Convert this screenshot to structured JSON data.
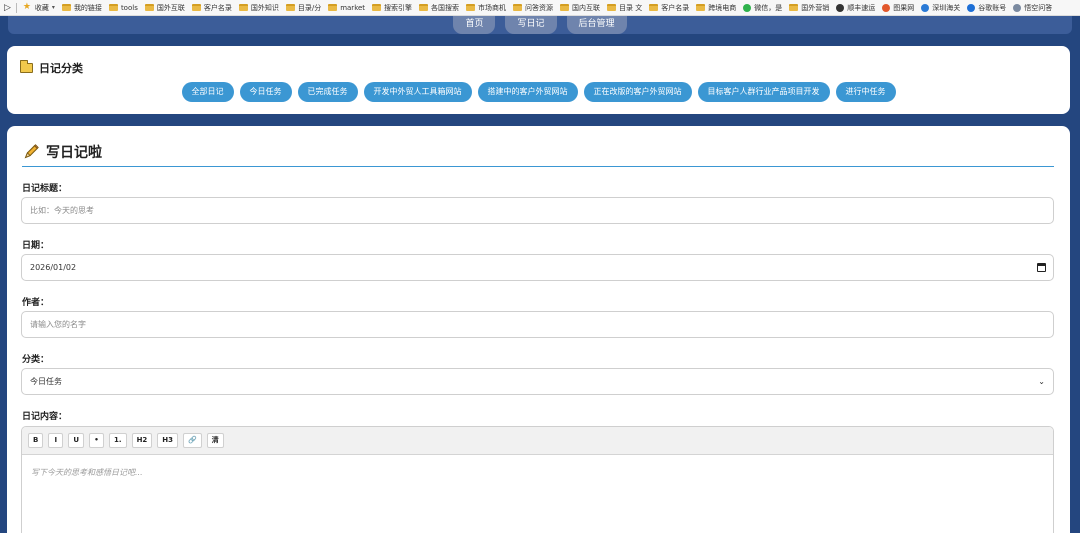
{
  "bookmarks": [
    {
      "label": "收藏",
      "icon": "star-icon",
      "caret": "▾"
    },
    {
      "label": "我的链接",
      "icon": "folder-icon"
    },
    {
      "label": "tools",
      "icon": "folder-icon"
    },
    {
      "label": "国外互联",
      "icon": "folder-icon"
    },
    {
      "label": "客户名录",
      "icon": "folder-icon"
    },
    {
      "label": "国外知识",
      "icon": "folder-icon"
    },
    {
      "label": "目录/分",
      "icon": "folder-icon"
    },
    {
      "label": "market",
      "icon": "folder-icon"
    },
    {
      "label": "搜索引擎",
      "icon": "folder-icon"
    },
    {
      "label": "各国搜索",
      "icon": "folder-icon"
    },
    {
      "label": "市场商机",
      "icon": "folder-icon"
    },
    {
      "label": "问答资源",
      "icon": "folder-icon"
    },
    {
      "label": "国内互联",
      "icon": "folder-icon"
    },
    {
      "label": "目录 文",
      "icon": "folder-icon"
    },
    {
      "label": "客户名录",
      "icon": "folder-icon"
    },
    {
      "label": "跨境电商",
      "icon": "folder-icon"
    },
    {
      "label": "微信，是",
      "icon": "wechat-icon"
    },
    {
      "label": "国外营销",
      "icon": "folder-icon"
    },
    {
      "label": "顺丰速运",
      "icon": "sf-express-icon"
    },
    {
      "label": "图果网",
      "icon": "tuguo-icon"
    },
    {
      "label": "深圳海关",
      "icon": "customs-icon"
    },
    {
      "label": "谷歌账号",
      "icon": "google-account-icon"
    },
    {
      "label": "悟空问答",
      "icon": "wukong-icon"
    }
  ],
  "nav": {
    "home": "首页",
    "write": "写日记",
    "admin": "后台管理"
  },
  "categories": {
    "title": "日记分类",
    "chips": [
      "全部日记",
      "今日任务",
      "已完成任务",
      "开发中外贸人工具箱网站",
      "搭建中的客户外贸网站",
      "正在改版的客户外贸网站",
      "目标客户人群行业产品项目开发",
      "进行中任务"
    ]
  },
  "form": {
    "heading": "写日记啦",
    "title_label": "日记标题：",
    "title_placeholder": "比如：今天的思考",
    "date_label": "日期：",
    "date_value": "2026/01/02",
    "author_label": "作者：",
    "author_placeholder": "请输入您的名字",
    "category_label": "分类：",
    "category_value": "今日任务",
    "content_label": "日记内容：",
    "toolbar": [
      "B",
      "I",
      "U",
      "•",
      "1.",
      "H2",
      "H3",
      "🔗",
      "清"
    ],
    "content_placeholder": "写下今天的思考和感悟日记吧..."
  }
}
